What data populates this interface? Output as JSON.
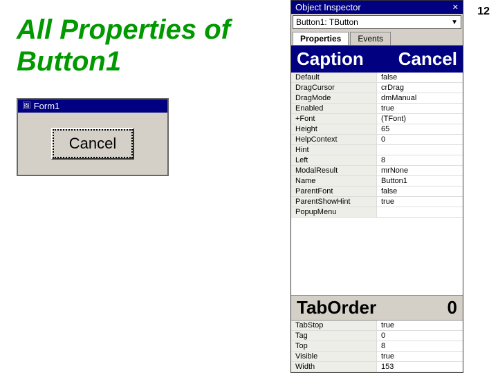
{
  "slide_number": "12",
  "left_panel": {
    "title_line1": "All Properties of",
    "title_line2": "Button1",
    "form_title": "Form1",
    "cancel_button_label": "Cancel"
  },
  "inspector": {
    "title": "Object Inspector",
    "close_button": "✕",
    "dropdown_value": "Button1: TButton",
    "tabs": [
      {
        "label": "Properties",
        "active": true
      },
      {
        "label": "Events",
        "active": false
      }
    ],
    "caption_label": "Caption",
    "caption_value": "Cancel",
    "properties": [
      {
        "name": "Default",
        "value": "false"
      },
      {
        "name": "DragCursor",
        "value": "crDrag"
      },
      {
        "name": "DragMode",
        "value": "dmManual"
      },
      {
        "name": "Enabled",
        "value": "true"
      },
      {
        "name": "+Font",
        "value": "(TFont)"
      },
      {
        "name": "Height",
        "value": "65"
      },
      {
        "name": "HelpContext",
        "value": "0"
      },
      {
        "name": "Hint",
        "value": ""
      },
      {
        "name": "Left",
        "value": "8"
      },
      {
        "name": "ModalResult",
        "value": "mrNone"
      },
      {
        "name": "Name",
        "value": "Button1"
      },
      {
        "name": "ParentFont",
        "value": "false"
      },
      {
        "name": "ParentShowHint",
        "value": "true"
      },
      {
        "name": "PopupMenu",
        "value": ""
      }
    ],
    "taborder_label": "TabOrder",
    "taborder_value": "0",
    "bottom_properties": [
      {
        "name": "TabStop",
        "value": "true"
      },
      {
        "name": "Tag",
        "value": "0"
      },
      {
        "name": "Top",
        "value": "8"
      },
      {
        "name": "Visible",
        "value": "true"
      },
      {
        "name": "Width",
        "value": "153"
      }
    ]
  }
}
